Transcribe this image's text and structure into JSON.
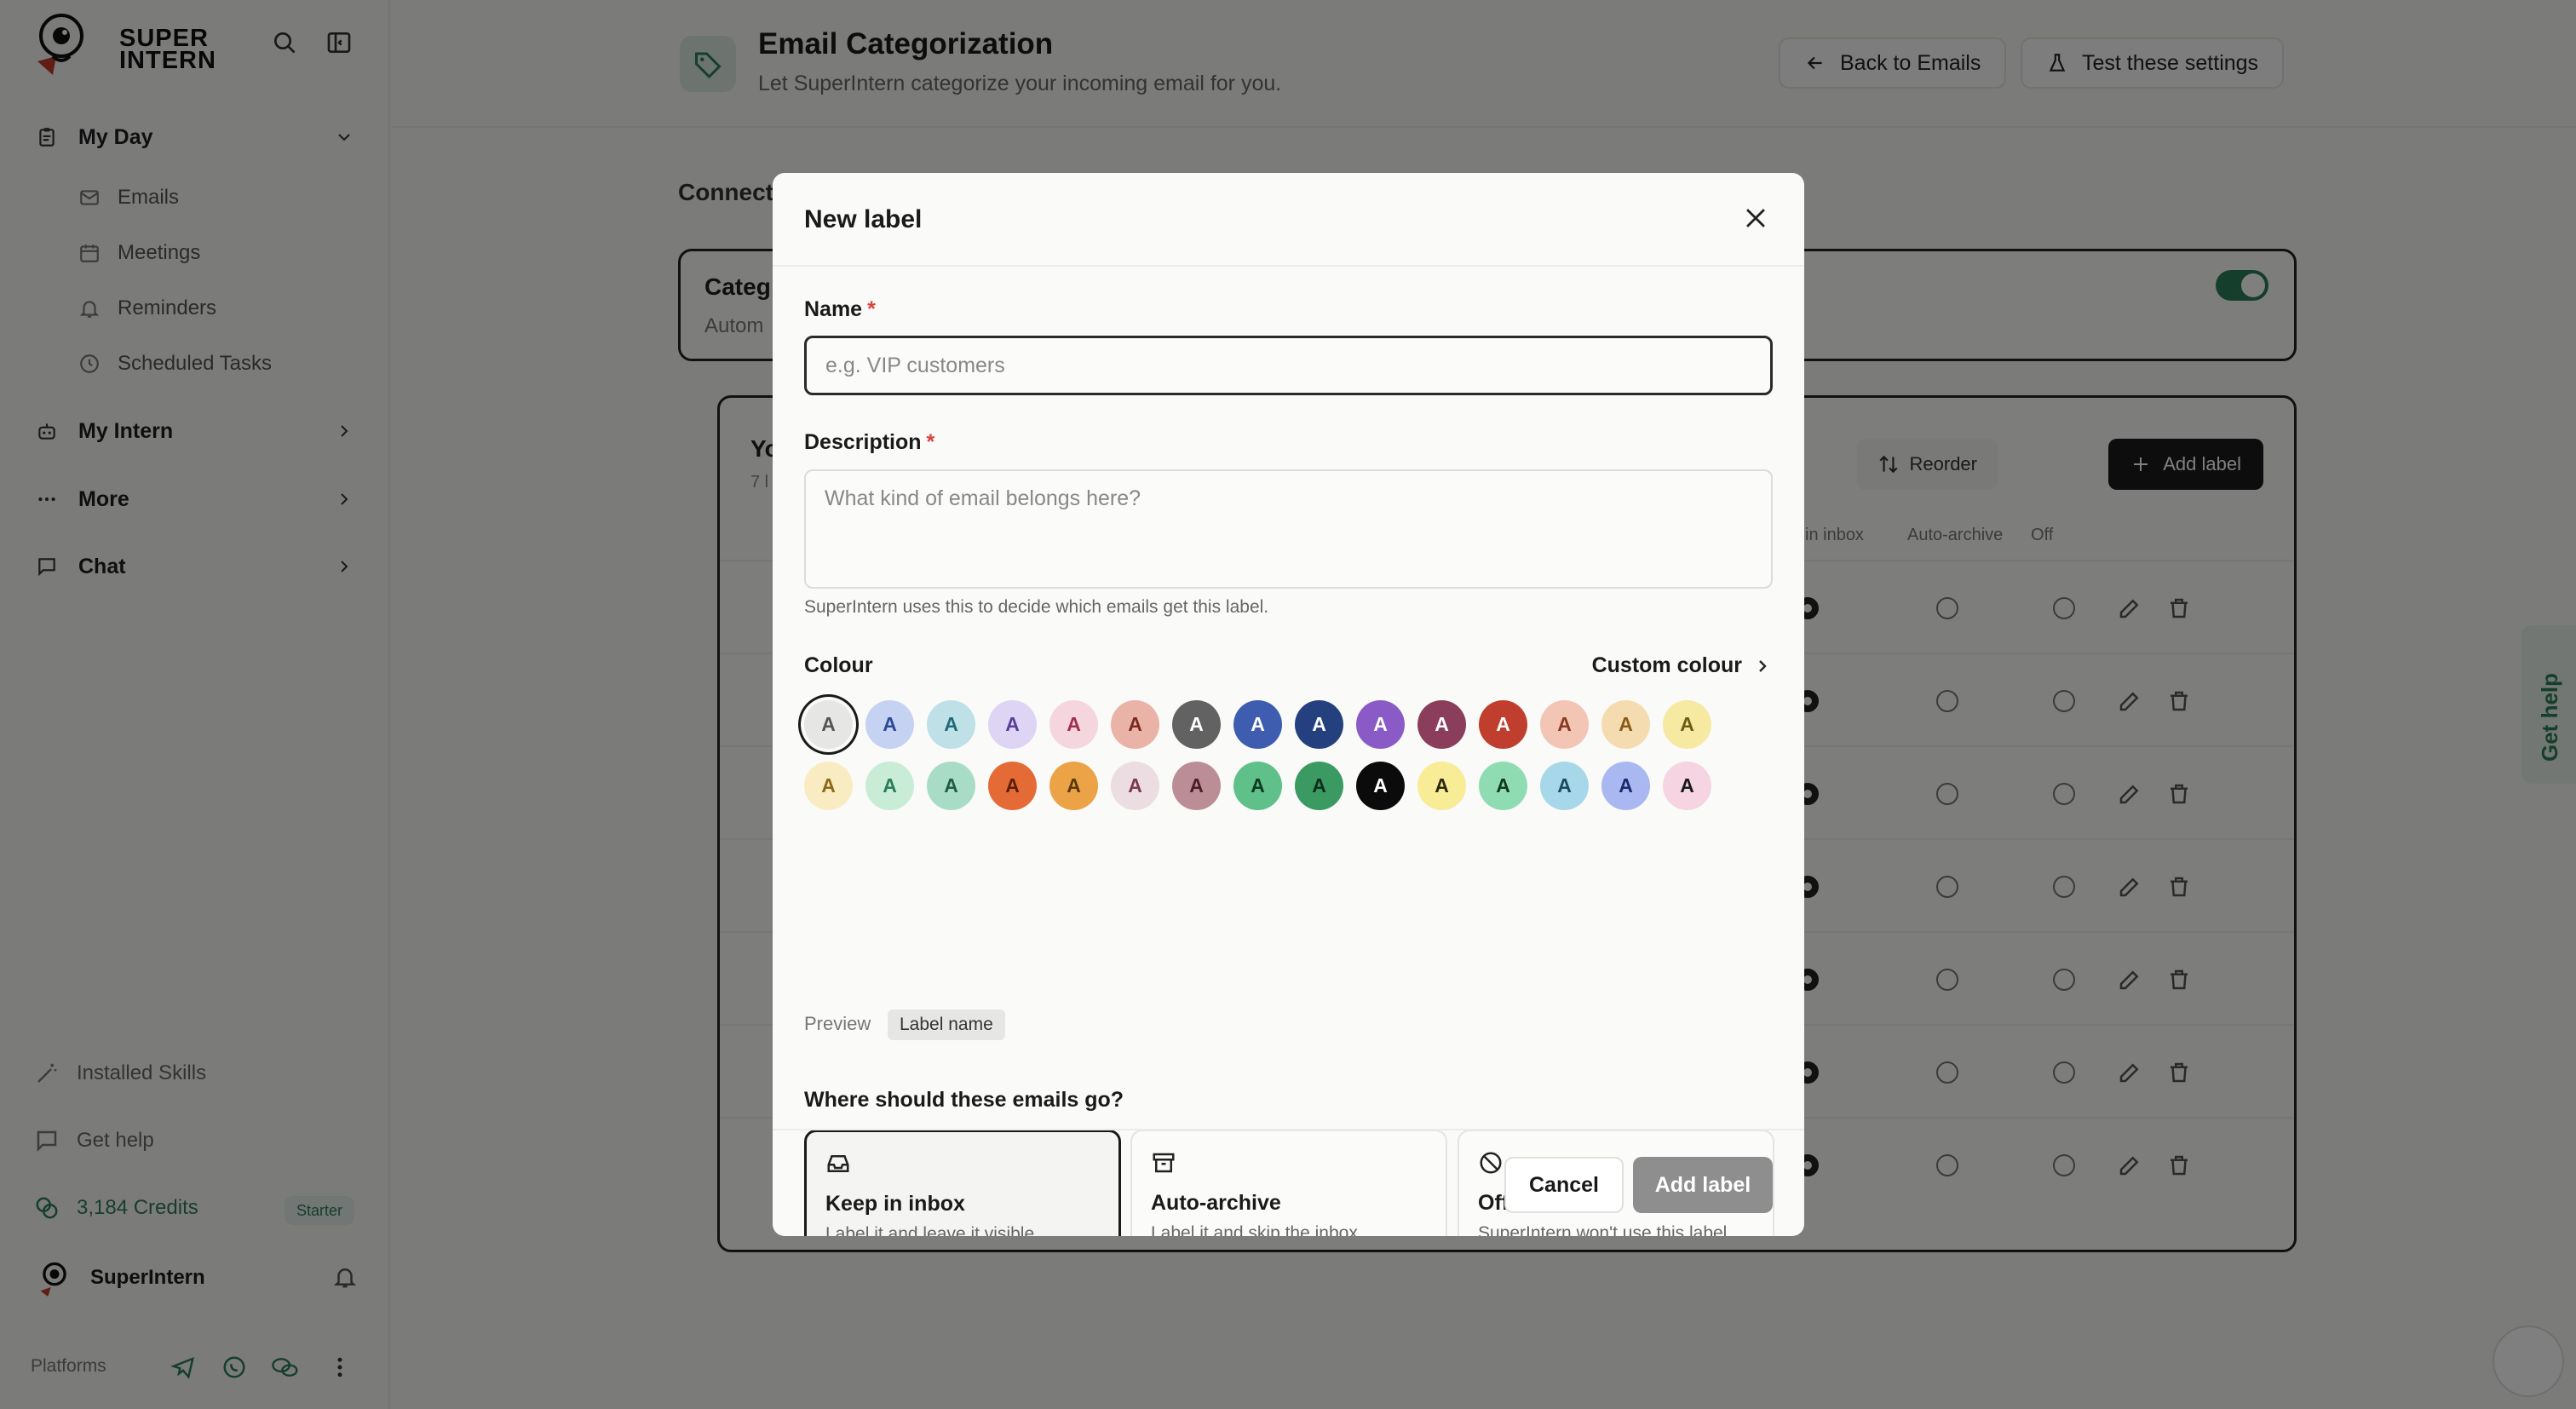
{
  "sidebar": {
    "logo": {
      "line1": "SUPER",
      "line2": "INTERN"
    },
    "nav": [
      {
        "label": "My Day",
        "icon": "clipboard-icon"
      },
      {
        "label": "My Intern",
        "icon": "robot-icon"
      },
      {
        "label": "More",
        "icon": "ellipsis-icon"
      },
      {
        "label": "Chat",
        "icon": "chat-icon"
      }
    ],
    "my_day_items": [
      {
        "label": "Emails",
        "icon": "mail-icon"
      },
      {
        "label": "Meetings",
        "icon": "calendar-icon"
      },
      {
        "label": "Reminders",
        "icon": "bell-icon"
      },
      {
        "label": "Scheduled Tasks",
        "icon": "clock-icon"
      }
    ],
    "installed_skills": "Installed Skills",
    "get_help": "Get help",
    "credits": "3,184 Credits",
    "plan": "Starter",
    "user": "SuperIntern",
    "platforms": "Platforms"
  },
  "header": {
    "title": "Email Categorization",
    "subtitle": "Let SuperIntern categorize your incoming email for you.",
    "back_label": "Back to Emails",
    "test_label": "Test these settings"
  },
  "background": {
    "connected_label": "Connect",
    "card_title": "Categ",
    "card_sub": "Autom",
    "list_title": "Yo",
    "list_sub": "7 l",
    "reorder_label": "Reorder",
    "add_label": "Add label",
    "columns": {
      "inbox": "in inbox",
      "archive": "Auto-archive",
      "off": "Off"
    },
    "row_count": 7
  },
  "modal": {
    "title": "New label",
    "name_label": "Name",
    "name_placeholder": "e.g. VIP customers",
    "name_value": "",
    "description_label": "Description",
    "description_placeholder": "What kind of email belongs here?",
    "description_hint": "SuperIntern uses this to decide which emails get this label.",
    "colour_label": "Colour",
    "custom_colour_label": "Custom colour",
    "swatch_glyph": "A",
    "selected_swatch": 0,
    "swatches": [
      {
        "bg": "#e6e6e4",
        "fg": "#555555"
      },
      {
        "bg": "#c5d2f2",
        "fg": "#2c4a9a"
      },
      {
        "bg": "#bfe0e6",
        "fg": "#1f6b78"
      },
      {
        "bg": "#ddd5f3",
        "fg": "#5a3e9e"
      },
      {
        "bg": "#f6d6de",
        "fg": "#a0304f"
      },
      {
        "bg": "#eab3a8",
        "fg": "#7a2a20"
      },
      {
        "bg": "#626262",
        "fg": "#ffffff"
      },
      {
        "bg": "#3f5db0",
        "fg": "#ffffff"
      },
      {
        "bg": "#25407e",
        "fg": "#ffffff"
      },
      {
        "bg": "#8a5bc6",
        "fg": "#ffffff"
      },
      {
        "bg": "#8b3e5c",
        "fg": "#ffffff"
      },
      {
        "bg": "#bf3e2e",
        "fg": "#ffffff"
      },
      {
        "bg": "#f3c5b5",
        "fg": "#8a3a22"
      },
      {
        "bg": "#f4dcb0",
        "fg": "#8a5a16"
      },
      {
        "bg": "#f6eaa2",
        "fg": "#6e5d10"
      },
      {
        "bg": "#faecc2",
        "fg": "#8a6a16"
      },
      {
        "bg": "#c8ecd6",
        "fg": "#2d7d5a"
      },
      {
        "bg": "#a9dcc7",
        "fg": "#1f5d44"
      },
      {
        "bg": "#e46b36",
        "fg": "#5a1f08"
      },
      {
        "bg": "#eca247",
        "fg": "#5a3a08"
      },
      {
        "bg": "#ecdde2",
        "fg": "#7a3a4e"
      },
      {
        "bg": "#bb8e95",
        "fg": "#4a1e26"
      },
      {
        "bg": "#5fc08a",
        "fg": "#0e3a22"
      },
      {
        "bg": "#3a9a62",
        "fg": "#0e2e1a"
      },
      {
        "bg": "#0b0b0b",
        "fg": "#ffffff"
      },
      {
        "bg": "#f8ec96",
        "fg": "#2a2a10"
      },
      {
        "bg": "#8fdcb2",
        "fg": "#0e3a22"
      },
      {
        "bg": "#a6d8ea",
        "fg": "#1a4a5e"
      },
      {
        "bg": "#a9b8f0",
        "fg": "#1a2a6e"
      },
      {
        "bg": "#f6d4e2",
        "fg": "#1a1a1a"
      }
    ],
    "preview_label": "Preview",
    "preview_chip": "Label name",
    "destination_question": "Where should these emails go?",
    "options": [
      {
        "title": "Keep in inbox",
        "desc": "Label it and leave it visible.",
        "icon": "inbox-icon",
        "selected": true
      },
      {
        "title": "Auto-archive",
        "desc": "Label it and skip the inbox.",
        "icon": "archive-icon",
        "selected": false
      },
      {
        "title": "Off",
        "desc": "SuperIntern won't use this label.",
        "icon": "ban-icon",
        "selected": false
      }
    ],
    "cancel_label": "Cancel",
    "submit_label": "Add label"
  },
  "help_tab": "Get help"
}
